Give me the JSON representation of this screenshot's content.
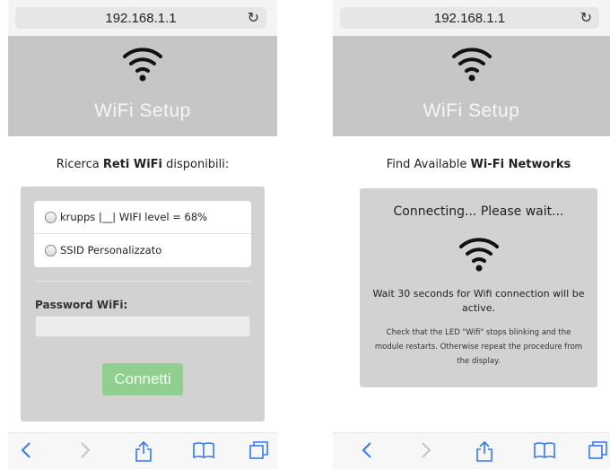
{
  "left": {
    "address_bar": {
      "url": "192.168.1.1"
    },
    "header": {
      "title": "WiFi Setup"
    },
    "subtitle": {
      "prefix": "Ricerca ",
      "bold": "Reti WiFi",
      "suffix": " disponibili:"
    },
    "networks": [
      {
        "label": "krupps |__| WIFI level = 68%"
      },
      {
        "label": "SSID Personalizzato"
      }
    ],
    "password_label": "Password WiFi:",
    "password_value": "",
    "connect_button": "Connetti"
  },
  "right": {
    "address_bar": {
      "url": "192.168.1.1"
    },
    "header": {
      "title": "WiFi Setup"
    },
    "subtitle": {
      "prefix": "Find Available ",
      "bold": "Wi-Fi Networks"
    },
    "connecting_text": "Connecting... Please wait...",
    "wait_text": "Wait 30 seconds for Wifi connection will be active.",
    "check_text": "Check that the LED \"Wifi\" stops blinking and the module restarts. Otherwise repeat the procedure from the display."
  },
  "icons": {
    "wifi": "wifi-icon",
    "reload": "reload-icon",
    "back": "back-icon",
    "forward": "forward-icon",
    "share": "share-icon",
    "bookmarks": "bookmarks-icon",
    "tabs": "tabs-icon"
  },
  "colors": {
    "header_bg": "#c6c6c6",
    "panel_bg": "#d2d2d2",
    "button_green": "#8fcf90",
    "toolbar_blue": "#3478f6"
  }
}
